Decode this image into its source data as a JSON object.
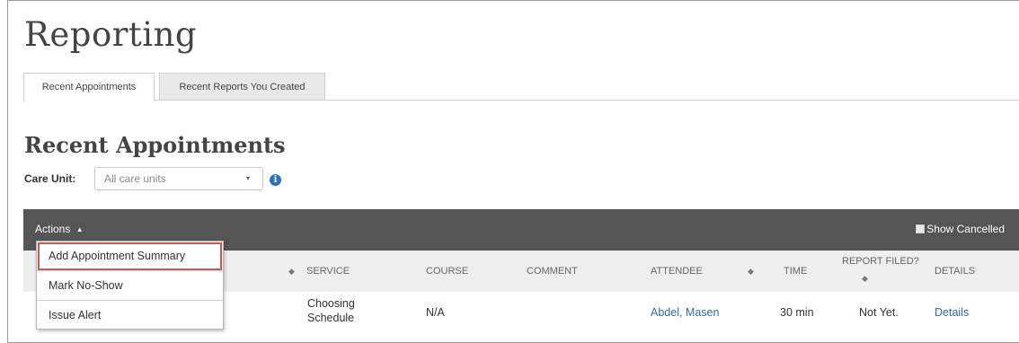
{
  "page": {
    "title": "Reporting"
  },
  "tabs": [
    {
      "label": "Recent Appointments",
      "active": true
    },
    {
      "label": "Recent Reports You Created",
      "active": false
    }
  ],
  "section": {
    "title": "Recent Appointments"
  },
  "care_unit": {
    "label": "Care Unit:",
    "value": "All care units",
    "caret": "▾",
    "info": "i"
  },
  "toolbar": {
    "actions_label": "Actions",
    "actions_icon": "▲",
    "show_cancelled_label": "Show Cancelled"
  },
  "actions_menu": [
    {
      "label": "Add Appointment Summary"
    },
    {
      "label": "Mark No-Show"
    },
    {
      "label": "Issue Alert"
    }
  ],
  "table": {
    "headers": {
      "sort_icon": "◆",
      "service": "SERVICE",
      "course": "COURSE",
      "comment": "COMMENT",
      "attendee": "ATTENDEE",
      "time": "TIME",
      "report_filed": "REPORT FILED?",
      "details": "DETAILS"
    },
    "rows": [
      {
        "service_line1": "Choosing",
        "service_line2": "Schedule",
        "course": "N/A",
        "attendee": "Abdel, Masen",
        "time": "30 min",
        "report_filed": "Not Yet.",
        "details": "Details"
      }
    ]
  },
  "colors": {
    "toolbar_bg": "#555555",
    "link": "#2a6bc1",
    "highlight_outline": "#d9534f",
    "info_icon": "#2b6fc6"
  }
}
